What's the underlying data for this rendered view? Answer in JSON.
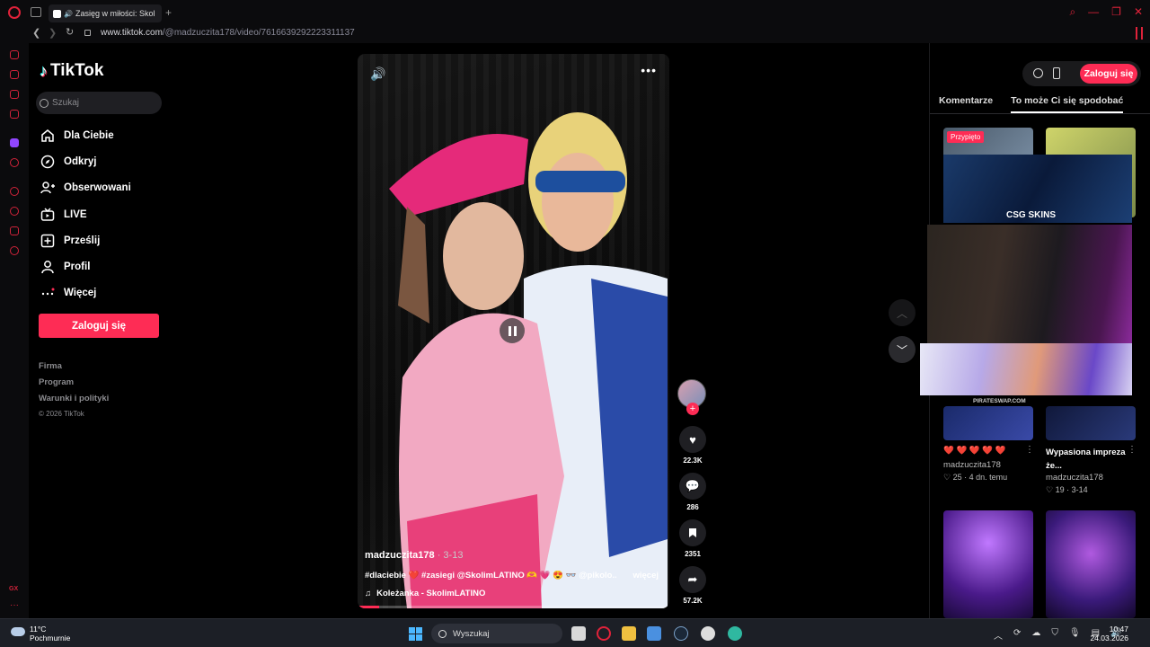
{
  "browser": {
    "tab_title": "Zasięg w miłości: Skol",
    "url_host": "www.tiktok.com",
    "url_path": "/@madzuczita178/video/7616639292223311137"
  },
  "sidebar": {
    "logo_text": "TikTok",
    "search_placeholder": "Szukaj",
    "nav": [
      {
        "label": "Dla Ciebie",
        "icon": "home-icon"
      },
      {
        "label": "Odkryj",
        "icon": "compass-icon"
      },
      {
        "label": "Obserwowani",
        "icon": "following-icon"
      },
      {
        "label": "LIVE",
        "icon": "live-icon"
      },
      {
        "label": "Prześlij",
        "icon": "upload-icon"
      },
      {
        "label": "Profil",
        "icon": "profile-icon"
      },
      {
        "label": "Więcej",
        "icon": "more-dots-icon"
      }
    ],
    "login_label": "Zaloguj się",
    "footer": [
      "Firma",
      "Program",
      "Warunki i polityki"
    ],
    "copyright": "© 2026 TikTok"
  },
  "video": {
    "username": "madzuczita178",
    "date": " · 3-13",
    "caption": "#dlaciebie ❤️ #zasiegi @SkolimLATINO 🫶 💗 😍 👓 @pikolo...",
    "more_label": "więcej",
    "music": "Koleżanka - SkolimLATINO",
    "progress": 0.07
  },
  "actions": {
    "likes": "22.3K",
    "comments": "286",
    "saves": "2351",
    "shares": "57.2K"
  },
  "right_panel": {
    "login_label": "Zaloguj się",
    "tabs": [
      "Komentarze",
      "To może Ci się spodobać"
    ],
    "active_tab": 1,
    "pinned_label": "Przypięto",
    "ad_text": "CSG SKINS",
    "stream_banner_text": "PIRATESWAP.COM",
    "items": [
      {
        "title": "❤️ ❤️ ❤️ ❤️ ❤️",
        "user": "madzuczita178",
        "stats": "♡ 25 · 4 dn. temu"
      },
      {
        "title": "Wypasiona impreza że...",
        "user": "madzuczita178",
        "stats": "♡ 19 · 3-14"
      }
    ]
  },
  "taskbar": {
    "temp": "11°C",
    "weather": "Pochmurnie",
    "search_label": "Wyszukaj",
    "time": "10:47",
    "date": "24.03.2026"
  },
  "colors": {
    "accent": "#fe2c55",
    "opera": "#e0223a",
    "background": "#000000"
  }
}
